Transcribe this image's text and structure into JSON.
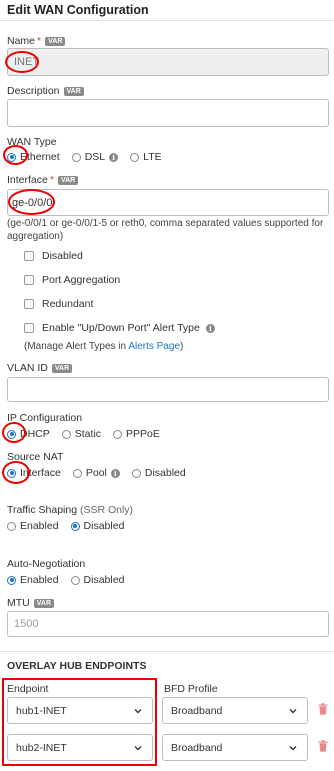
{
  "panel": {
    "title": "Edit WAN Configuration"
  },
  "var_badge": "VAR",
  "name": {
    "label": "Name",
    "required_mark": "*",
    "value": "INET"
  },
  "description": {
    "label": "Description",
    "value": ""
  },
  "wan_type": {
    "label": "WAN Type",
    "options": [
      "Ethernet",
      "DSL",
      "LTE"
    ],
    "selected": "Ethernet"
  },
  "interface": {
    "label": "Interface",
    "required_mark": "*",
    "value": "ge-0/0/0",
    "hint": "(ge-0/0/1 or ge-0/0/1-5 or reth0, comma separated values supported for aggregation)"
  },
  "checkboxes": [
    {
      "label": "Disabled",
      "checked": false
    },
    {
      "label": "Port Aggregation",
      "checked": false
    },
    {
      "label": "Redundant",
      "checked": false
    },
    {
      "label": "Enable \"Up/Down Port\" Alert Type",
      "checked": false
    }
  ],
  "alert_hint": {
    "prefix": "(Manage Alert Types in ",
    "link": "Alerts Page",
    "suffix": ")"
  },
  "vlan": {
    "label": "VLAN ID",
    "value": ""
  },
  "ip_configuration": {
    "label": "IP Configuration",
    "options": [
      "DHCP",
      "Static",
      "PPPoE"
    ],
    "selected": "DHCP"
  },
  "source_nat": {
    "label": "Source NAT",
    "options": [
      "Interface",
      "Pool",
      "Disabled"
    ],
    "selected": "Interface"
  },
  "traffic_shaping": {
    "label": "Traffic Shaping",
    "label_suffix": "(SSR Only)",
    "options": [
      "Enabled",
      "Disabled"
    ],
    "selected": "Disabled"
  },
  "auto_negotiation": {
    "label": "Auto-Negotiation",
    "options": [
      "Enabled",
      "Disabled"
    ],
    "selected": "Enabled"
  },
  "mtu": {
    "label": "MTU",
    "placeholder": "1500"
  },
  "overlay": {
    "heading": "OVERLAY HUB ENDPOINTS",
    "col_endpoint": "Endpoint",
    "col_bfd": "BFD Profile",
    "rows": [
      {
        "endpoint": "hub1-INET",
        "bfd": "Broadband"
      },
      {
        "endpoint": "hub2-INET",
        "bfd": "Broadband"
      }
    ]
  },
  "colors": {
    "accent": "#1a73c7",
    "required": "#e53935",
    "annotation": "#e00000"
  }
}
